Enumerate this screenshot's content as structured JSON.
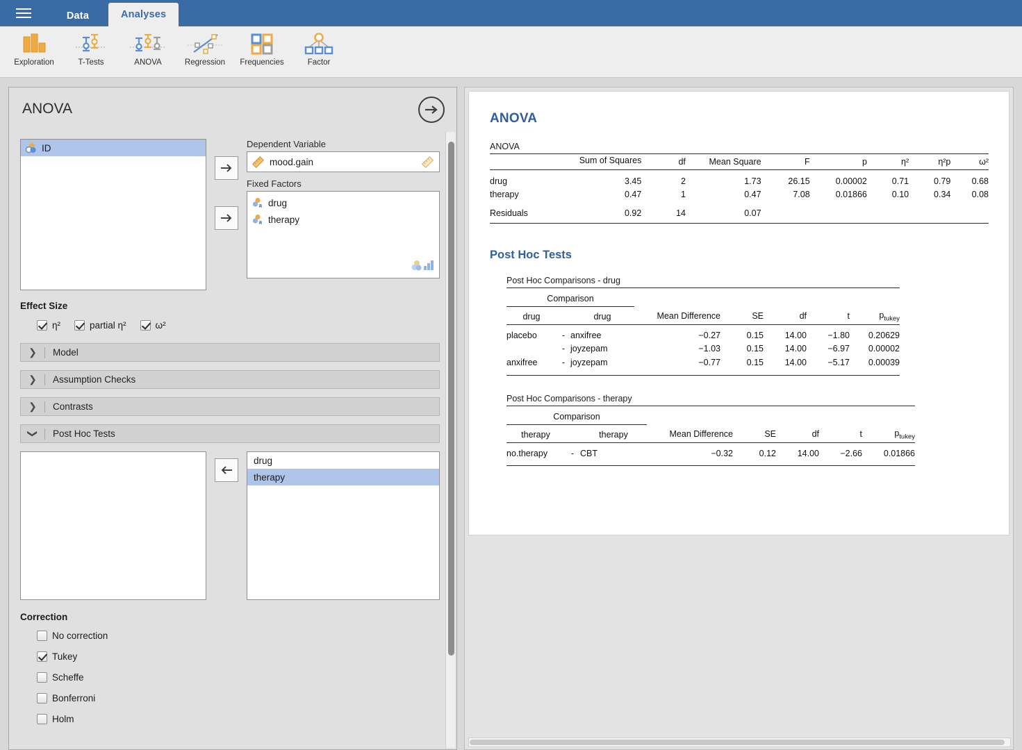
{
  "app": {
    "menu_icon": "hamburger-icon",
    "tabs": [
      {
        "label": "Data",
        "active": false
      },
      {
        "label": "Analyses",
        "active": true
      }
    ]
  },
  "ribbon": {
    "items": [
      {
        "label": "Exploration",
        "icon": "bar-chart-icon"
      },
      {
        "label": "T-Tests",
        "icon": "error-bars-icon"
      },
      {
        "label": "ANOVA",
        "icon": "anova-error-bars-icon"
      },
      {
        "label": "Regression",
        "icon": "scatter-line-icon"
      },
      {
        "label": "Frequencies",
        "icon": "four-squares-icon"
      },
      {
        "label": "Factor",
        "icon": "factor-tree-icon"
      }
    ]
  },
  "options": {
    "title": "ANOVA",
    "forward_arrow": "arrow-right-circle-icon",
    "variable_supplier": {
      "items": [
        {
          "label": "ID",
          "type": "nominal-id",
          "selected": true
        }
      ]
    },
    "dependent_variable": {
      "label": "Dependent Variable",
      "value": "mood.gain",
      "type": "continuous",
      "transfer_button": "arrow-right-icon"
    },
    "fixed_factors": {
      "label": "Fixed Factors",
      "values": [
        {
          "label": "drug",
          "type": "nominal-text"
        },
        {
          "label": "therapy",
          "type": "nominal-text"
        }
      ],
      "transfer_button": "arrow-right-icon"
    },
    "effect_size": {
      "title": "Effect Size",
      "items": [
        {
          "label": "η²",
          "checked": true
        },
        {
          "label": "partial η²",
          "checked": true
        },
        {
          "label": "ω²",
          "checked": true
        }
      ]
    },
    "sections": [
      {
        "label": "Model",
        "expanded": false
      },
      {
        "label": "Assumption Checks",
        "expanded": false
      },
      {
        "label": "Contrasts",
        "expanded": false
      },
      {
        "label": "Post Hoc Tests",
        "expanded": true
      }
    ],
    "post_hoc": {
      "available": [],
      "transfer_button": "arrow-left-icon",
      "selected_items": [
        {
          "label": "drug",
          "selected": false
        },
        {
          "label": "therapy",
          "selected": true
        }
      ]
    },
    "correction": {
      "title": "Correction",
      "items": [
        {
          "label": "No correction",
          "checked": false
        },
        {
          "label": "Tukey",
          "checked": true
        },
        {
          "label": "Scheffe",
          "checked": false
        },
        {
          "label": "Bonferroni",
          "checked": false
        },
        {
          "label": "Holm",
          "checked": false
        }
      ]
    }
  },
  "results": {
    "heading": "ANOVA",
    "anova_table": {
      "caption": "ANOVA",
      "columns": [
        "",
        "Sum of Squares",
        "df",
        "Mean Square",
        "F",
        "p",
        "η²",
        "η²p",
        "ω²"
      ],
      "rows": [
        {
          "name": "drug",
          "ss": "3.45",
          "df": "2",
          "ms": "1.73",
          "F": "26.15",
          "p": "0.00002",
          "eta": "0.71",
          "eta_p": "0.79",
          "omega": "0.68"
        },
        {
          "name": "therapy",
          "ss": "0.47",
          "df": "1",
          "ms": "0.47",
          "F": "7.08",
          "p": "0.01866",
          "eta": "0.10",
          "eta_p": "0.34",
          "omega": "0.08"
        },
        {
          "name": "Residuals",
          "ss": "0.92",
          "df": "14",
          "ms": "0.07",
          "F": "",
          "p": "",
          "eta": "",
          "eta_p": "",
          "omega": ""
        }
      ]
    },
    "post_hoc_heading": "Post Hoc Tests",
    "post_hoc_drug": {
      "caption": "Post Hoc Comparisons - drug",
      "group_header": "Comparison",
      "columns": [
        "drug",
        "drug",
        "Mean Difference",
        "SE",
        "df",
        "t",
        "p"
      ],
      "p_subscript": "tukey",
      "rows": [
        {
          "a": "placebo",
          "sep": "-",
          "b": "anxifree",
          "md": "−0.27",
          "se": "0.15",
          "df": "14.00",
          "t": "−1.80",
          "p": "0.20629"
        },
        {
          "a": "",
          "sep": "-",
          "b": "joyzepam",
          "md": "−1.03",
          "se": "0.15",
          "df": "14.00",
          "t": "−6.97",
          "p": "0.00002"
        },
        {
          "a": "anxifree",
          "sep": "-",
          "b": "joyzepam",
          "md": "−0.77",
          "se": "0.15",
          "df": "14.00",
          "t": "−5.17",
          "p": "0.00039"
        }
      ]
    },
    "post_hoc_therapy": {
      "caption": "Post Hoc Comparisons - therapy",
      "group_header": "Comparison",
      "columns": [
        "therapy",
        "therapy",
        "Mean Difference",
        "SE",
        "df",
        "t",
        "p"
      ],
      "p_subscript": "tukey",
      "rows": [
        {
          "a": "no.therapy",
          "sep": "-",
          "b": "CBT",
          "md": "−0.32",
          "se": "0.12",
          "df": "14.00",
          "t": "−2.66",
          "p": "0.01866"
        }
      ]
    }
  },
  "colors": {
    "titlebar": "#3a6ba5",
    "accent_heading": "#2f5f9e",
    "selection": "#aec4e8",
    "icon_orange": "#eeab43",
    "icon_blue": "#5a8ed6",
    "panel_bg": "#e0e0e0"
  }
}
